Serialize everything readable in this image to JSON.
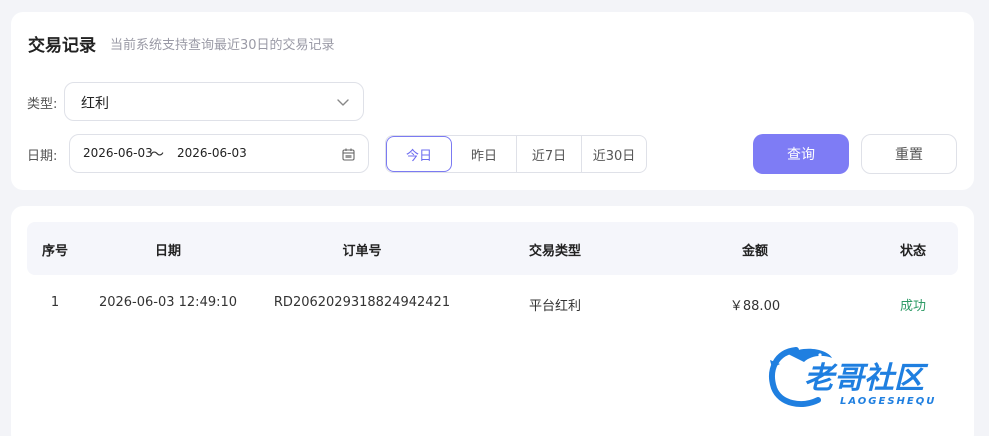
{
  "header": {
    "title": "交易记录",
    "subtitle": "当前系统支持查询最近30日的交易记录"
  },
  "filters": {
    "type_label": "类型:",
    "type_value": "红利",
    "date_label": "日期:",
    "date_start": "2026-06-03",
    "date_separator": "～",
    "date_end": "2026-06-03",
    "quick_ranges": [
      "今日",
      "昨日",
      "近7日",
      "近30日"
    ],
    "active_quick_range": "今日",
    "query_button": "查询",
    "reset_button": "重置"
  },
  "table": {
    "columns": [
      "序号",
      "日期",
      "订单号",
      "交易类型",
      "金额",
      "状态"
    ],
    "rows": [
      [
        "1",
        "2026-06-03 12:49:10",
        "RD206202931882494242​1",
        "平台红利",
        "￥88.00",
        "成功"
      ]
    ]
  },
  "watermark": {
    "text": "老哥社区",
    "subtext": "LAOGESHEQU"
  },
  "colors": {
    "accent": "#7e7cf5",
    "success": "#2e9b66",
    "watermark": "#1f7fe0"
  },
  "icons": {
    "select": "chevron-down-icon",
    "date": "calendar-icon",
    "logo": "dragon-logo-icon"
  }
}
